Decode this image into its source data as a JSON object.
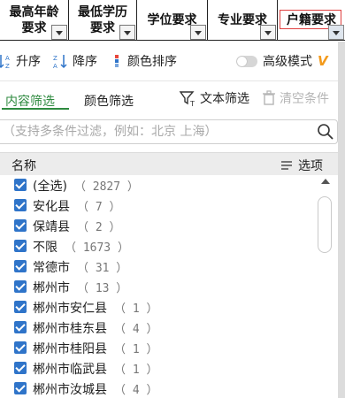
{
  "columns": [
    {
      "line1": "最高年龄",
      "line2": "要求"
    },
    {
      "line1": "最低学历",
      "line2": "要求"
    },
    {
      "line1": "学位要求",
      "line2": ""
    },
    {
      "line1": "专业要求",
      "line2": ""
    },
    {
      "line1": "户籍要求",
      "line2": ""
    }
  ],
  "sort": {
    "asc_label": "升序",
    "desc_label": "降序",
    "color_label": "颜色排序",
    "advanced_label": "高级模式",
    "vip_badge": "V"
  },
  "tabs": {
    "content_filter": "内容筛选",
    "color_filter": "颜色筛选",
    "text_filter": "文本筛选",
    "clear_conditions": "清空条件"
  },
  "search": {
    "placeholder": "（支持多条件过滤，例如：北京 上海）"
  },
  "list_header": {
    "name": "名称",
    "options": "选项"
  },
  "items": [
    {
      "label": "(全选)",
      "count": "（ 2827 ）"
    },
    {
      "label": "安化县",
      "count": "（ 7 ）"
    },
    {
      "label": "保靖县",
      "count": "（ 2 ）"
    },
    {
      "label": "不限",
      "count": "（ 1673 ）"
    },
    {
      "label": "常德市",
      "count": "（ 31 ）"
    },
    {
      "label": "郴州市",
      "count": "（ 13 ）"
    },
    {
      "label": "郴州市安仁县",
      "count": "（ 1 ）"
    },
    {
      "label": "郴州市桂东县",
      "count": "（ 4 ）"
    },
    {
      "label": "郴州市桂阳县",
      "count": "（ 1 ）"
    },
    {
      "label": "郴州市临武县",
      "count": "（ 1 ）"
    },
    {
      "label": "郴州市汝城县",
      "count": "（ 4 ）"
    }
  ],
  "colors": {
    "accent_green": "#2e8a3f",
    "checkbox_blue": "#2f74c9",
    "vip_orange": "#f39a1b",
    "active_border_red": "#e04040"
  }
}
